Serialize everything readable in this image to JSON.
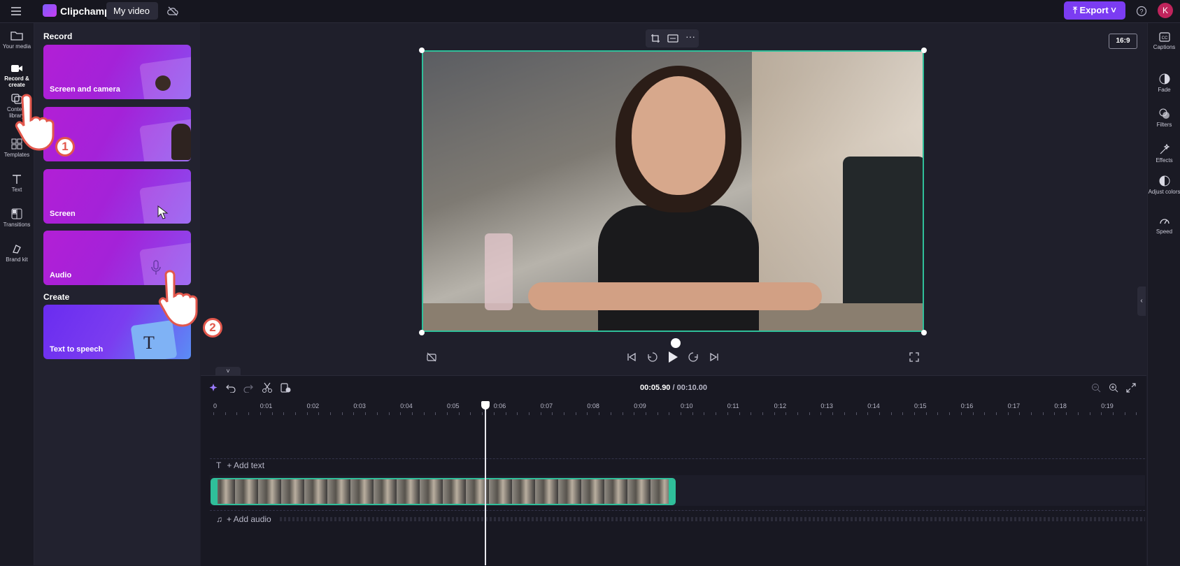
{
  "app": {
    "name": "Clipchamp",
    "project_tab": "My video",
    "export_label": "Export",
    "avatar_initial": "K"
  },
  "left_nav": [
    {
      "label": "Your media",
      "icon": "folder-icon"
    },
    {
      "label": "Record & create",
      "icon": "camera-icon",
      "active": true
    },
    {
      "label": "Content library",
      "icon": "library-icon"
    },
    {
      "label": "Templates",
      "icon": "templates-icon"
    },
    {
      "label": "Text",
      "icon": "text-icon"
    },
    {
      "label": "Transitions",
      "icon": "transitions-icon"
    },
    {
      "label": "Brand kit",
      "icon": "brand-icon"
    }
  ],
  "panel": {
    "record_heading": "Record",
    "create_heading": "Create",
    "cards": [
      {
        "label": "Screen and camera"
      },
      {
        "label": ""
      },
      {
        "label": "Screen"
      },
      {
        "label": "Audio"
      },
      {
        "label": "Text to speech"
      }
    ]
  },
  "preview": {
    "aspect_ratio": "16:9"
  },
  "right_nav": [
    {
      "label": "Captions",
      "icon": "cc-icon"
    },
    {
      "label": "Fade",
      "icon": "fade-icon"
    },
    {
      "label": "Filters",
      "icon": "filters-icon"
    },
    {
      "label": "Effects",
      "icon": "effects-icon"
    },
    {
      "label": "Adjust colors",
      "icon": "adjust-icon"
    },
    {
      "label": "Speed",
      "icon": "speed-icon"
    }
  ],
  "timeline": {
    "current_time": "00:05.90",
    "total_time": "/ 00:10.00",
    "ruler": [
      "0",
      "0:01",
      "0:02",
      "0:03",
      "0:04",
      "0:05",
      "0:06",
      "0:07",
      "0:08",
      "0:09",
      "0:10",
      "0:11",
      "0:12",
      "0:13",
      "0:14",
      "0:15",
      "0:16",
      "0:17",
      "0:18",
      "0:19"
    ],
    "add_text": "+ Add text",
    "add_audio": "+ Add audio"
  },
  "annotations": {
    "step1": "1",
    "step2": "2"
  },
  "colors": {
    "accent": "#7b3cf2",
    "clip_border": "#2fbf9a",
    "step_badge": "#e2574c"
  }
}
